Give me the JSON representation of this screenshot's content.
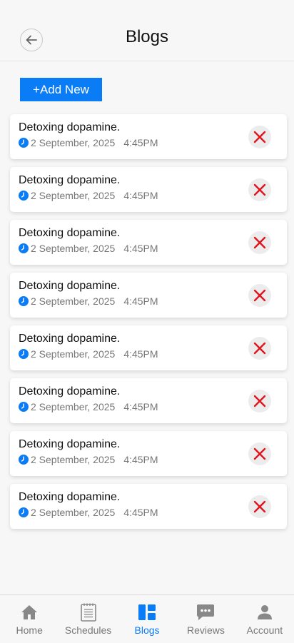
{
  "header": {
    "title": "Blogs"
  },
  "actions": {
    "add_label": "+Add New"
  },
  "colors": {
    "accent": "#0a7cf6",
    "delete": "#e0141e",
    "muted": "#777777"
  },
  "blogs": [
    {
      "title": "Detoxing dopamine.",
      "date": "2 September, 2025",
      "time": "4:45PM"
    },
    {
      "title": "Detoxing dopamine.",
      "date": "2 September, 2025",
      "time": "4:45PM"
    },
    {
      "title": "Detoxing dopamine.",
      "date": "2 September, 2025",
      "time": "4:45PM"
    },
    {
      "title": "Detoxing dopamine.",
      "date": "2 September, 2025",
      "time": "4:45PM"
    },
    {
      "title": "Detoxing dopamine.",
      "date": "2 September, 2025",
      "time": "4:45PM"
    },
    {
      "title": "Detoxing dopamine.",
      "date": "2 September, 2025",
      "time": "4:45PM"
    },
    {
      "title": "Detoxing dopamine.",
      "date": "2 September, 2025",
      "time": "4:45PM"
    },
    {
      "title": "Detoxing dopamine.",
      "date": "2 September, 2025",
      "time": "4:45PM"
    }
  ],
  "nav": [
    {
      "label": "Home",
      "icon": "home-icon",
      "active": false
    },
    {
      "label": "Schedules",
      "icon": "schedule-icon",
      "active": false
    },
    {
      "label": "Blogs",
      "icon": "blogs-icon",
      "active": true
    },
    {
      "label": "Reviews",
      "icon": "reviews-icon",
      "active": false
    },
    {
      "label": "Account",
      "icon": "account-icon",
      "active": false
    }
  ]
}
